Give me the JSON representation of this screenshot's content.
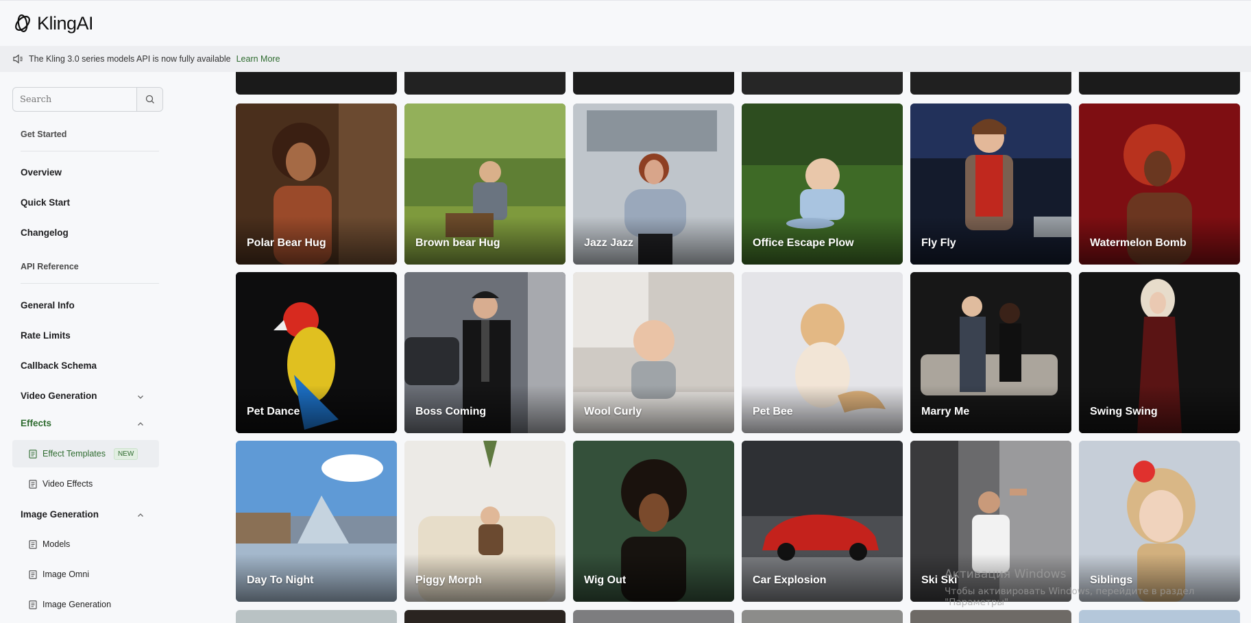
{
  "brand": {
    "name": "KlingAI"
  },
  "announcement": {
    "text": "The Kling 3.0 series models API is now fully available",
    "link": "Learn More"
  },
  "sidebar": {
    "search_placeholder": "Search",
    "get_started": "Get Started",
    "overview": "Overview",
    "quick_start": "Quick Start",
    "changelog": "Changelog",
    "api_reference": "API Reference",
    "general_info": "General Info",
    "rate_limits": "Rate Limits",
    "callback_schema": "Callback Schema",
    "video_generation": "Video Generation",
    "effects": "Effects",
    "effect_templates": "Effect Templates",
    "new_badge": "NEW",
    "video_effects": "Video Effects",
    "image_generation": "Image Generation",
    "models": "Models",
    "image_omni": "Image Omni",
    "image_generation_sub": "Image Generation"
  },
  "effects": [
    "Polar Bear Hug",
    "Brown bear Hug",
    "Jazz Jazz",
    "Office Escape Plow",
    "Fly Fly",
    "Watermelon Bomb",
    "Pet Dance",
    "Boss Coming",
    "Wool Curly",
    "Pet Bee",
    "Marry Me",
    "Swing Swing",
    "Day To Night",
    "Piggy Morph",
    "Wig Out",
    "Car Explosion",
    "Ski Ski",
    "Siblings"
  ],
  "watermark": {
    "line1": "Активация Windows",
    "line2": "Чтобы активировать Windows, перейдите в раздел \"Параметры\""
  },
  "colors": {
    "accent": "#2e6b2f",
    "sidebar_active_bg": "#eceef1"
  }
}
